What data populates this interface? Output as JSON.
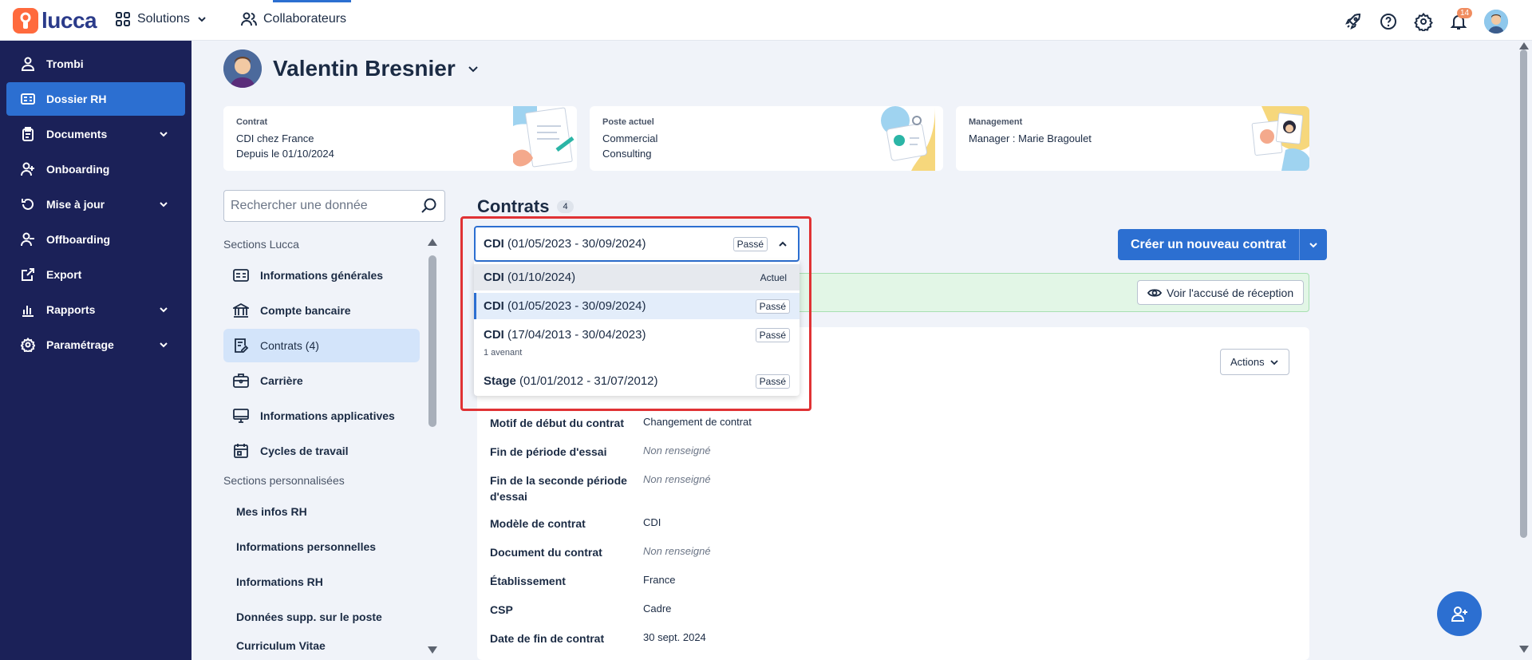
{
  "topbar": {
    "logo": "lucca",
    "solutions_label": "Solutions",
    "collaborateurs_label": "Collaborateurs",
    "notification_count": "14"
  },
  "sidebar": {
    "items": [
      {
        "label": "Trombi"
      },
      {
        "label": "Dossier RH"
      },
      {
        "label": "Documents"
      },
      {
        "label": "Onboarding"
      },
      {
        "label": "Mise à jour"
      },
      {
        "label": "Offboarding"
      },
      {
        "label": "Export"
      },
      {
        "label": "Rapports"
      },
      {
        "label": "Paramétrage"
      }
    ]
  },
  "person": {
    "name": "Valentin Bresnier"
  },
  "cards": {
    "contrat": {
      "title": "Contrat",
      "line1": "CDI chez France",
      "line2": "Depuis le 01/10/2024"
    },
    "poste": {
      "title": "Poste actuel",
      "line1": "Commercial",
      "line2": "Consulting"
    },
    "management": {
      "title": "Management",
      "line1": "Manager : Marie Bragoulet"
    }
  },
  "search": {
    "placeholder": "Rechercher une donnée"
  },
  "sections": {
    "lucca_title": "Sections Lucca",
    "lucca_items": [
      {
        "label": "Informations générales"
      },
      {
        "label": "Compte bancaire"
      },
      {
        "label": "Contrats (4)"
      },
      {
        "label": "Carrière"
      },
      {
        "label": "Informations applicatives"
      },
      {
        "label": "Cycles de travail"
      }
    ],
    "custom_title": "Sections personnalisées",
    "custom_items": [
      {
        "label": "Mes infos RH"
      },
      {
        "label": "Informations personnelles"
      },
      {
        "label": "Informations RH"
      },
      {
        "label": "Données supp. sur le poste"
      },
      {
        "label": "Curriculum Vitae"
      }
    ]
  },
  "contrats": {
    "title": "Contrats",
    "count": "4",
    "create_label": "Créer un nouveau contrat",
    "receipt_label": "Voir l'accusé de réception",
    "actions_label": "Actions",
    "select": {
      "kind": "CDI",
      "range": "(01/05/2023 - 30/09/2024)",
      "status": "Passé"
    },
    "options": [
      {
        "kind": "CDI",
        "range": "(01/10/2024)",
        "status": "Actuel"
      },
      {
        "kind": "CDI",
        "range": "(01/05/2023 - 30/09/2024)",
        "status": "Passé"
      },
      {
        "kind": "CDI",
        "range": "(17/04/2013 - 30/04/2023)",
        "status": "Passé",
        "sub": "1 avenant"
      },
      {
        "kind": "Stage",
        "range": "(01/01/2012 - 31/07/2012)",
        "status": "Passé"
      }
    ],
    "fields": [
      {
        "label": "Motif de début du contrat",
        "value": "Changement de contrat"
      },
      {
        "label": "Fin de période d'essai",
        "value": "Non renseigné"
      },
      {
        "label": "Fin de la seconde période d'essai",
        "value": "Non renseigné"
      },
      {
        "label": "Modèle de contrat",
        "value": "CDI"
      },
      {
        "label": "Document du contrat",
        "value": "Non renseigné"
      },
      {
        "label": "Établissement",
        "value": "France"
      },
      {
        "label": "CSP",
        "value": "Cadre"
      },
      {
        "label": "Date de fin de contrat",
        "value": "30 sept. 2024"
      }
    ]
  }
}
